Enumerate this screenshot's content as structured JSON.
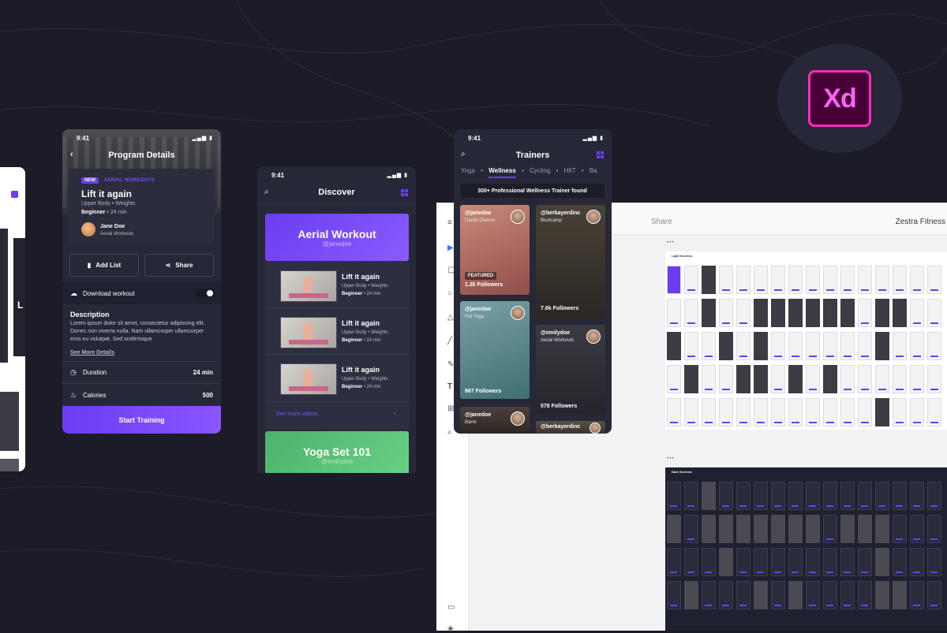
{
  "status_time": "9:41",
  "program_details": {
    "title": "Program Details",
    "badge": "NEW",
    "category": "AERIAL WORKOUTS",
    "workout_title": "Lift it again",
    "tags": "Upper Body • Weights",
    "level": "Beginner",
    "level_duration": "• 24 min",
    "coach_name": "Jane Doe",
    "coach_role": "Aerial Workouts",
    "add_list_label": "Add List",
    "share_label": "Share",
    "download_label": "Download workout",
    "description_heading": "Description",
    "description_text": "Lorem ipsum dolor sit amet, consectetur adipiscing elit. Donec non viverra nulla. Nam ullamcorper ullamcorper eros eu volutpat. Sed scelerisque",
    "see_more_label": "See More Details",
    "duration_label": "Duration",
    "duration_value": "24 min",
    "calories_label": "Calories",
    "calories_value": "500",
    "start_label": "Start Training"
  },
  "discover": {
    "title": "Discover",
    "banner_title": "Aerial Workout",
    "banner_author": "@janedoe",
    "videos": [
      {
        "title": "Lift it again",
        "tags": "Upper Body • Weights",
        "level": "Beginner",
        "duration": "• 24 min"
      },
      {
        "title": "Lift it again",
        "tags": "Upper Body • Weights",
        "level": "Beginner",
        "duration": "• 24 min"
      },
      {
        "title": "Lift it again",
        "tags": "Upper Body • Weights",
        "level": "Beginner",
        "duration": "• 24 min"
      }
    ],
    "see_more_label": "See more videos",
    "banner2_title": "Yoga Set 101",
    "banner2_author": "@emilydoe"
  },
  "trainers": {
    "title": "Trainers",
    "tabs": [
      "Yoga",
      "Wellness",
      "Cycling",
      "HIIT",
      "Ba"
    ],
    "active_tab": "Wellness",
    "found_text": "300+ Professional Wellness Trainer found",
    "cards": [
      {
        "handle": "@janedoe",
        "role": "Cardio Dancer",
        "badge": "FEATURED",
        "followers": "1.2k Followers"
      },
      {
        "handle": "@berkayerdinc",
        "role": "Bootcamp",
        "followers": "7.6k Followers"
      },
      {
        "handle": "@janedoe",
        "role": "Hot Yoga",
        "followers": "867 Followers"
      },
      {
        "handle": "@emilydoe",
        "role": "Aerial Workouts",
        "followers": "578 Followers"
      },
      {
        "handle": "@janedoe",
        "role": "Barre"
      },
      {
        "handle": "@berkayerdinc",
        "role": ""
      }
    ]
  },
  "xd_window": {
    "share_label": "Share",
    "project_name": "Zestra Fitness",
    "artboard_light_title": "Light Screens",
    "artboard_dark_title": "Dark Screens"
  },
  "partial_card_text": "L",
  "logo_text": "Xd",
  "colors": {
    "background": "#1b1c27",
    "card": "#262837",
    "accent": "#6c3cf5",
    "xd_pink": "#ff2bc2",
    "xd_fill": "#470137"
  },
  "icons": [
    "search-icon",
    "grid-icon",
    "back-icon",
    "bookmark-icon",
    "share-icon",
    "download-icon",
    "clock-icon",
    "flame-icon",
    "chevron-right-icon"
  ]
}
